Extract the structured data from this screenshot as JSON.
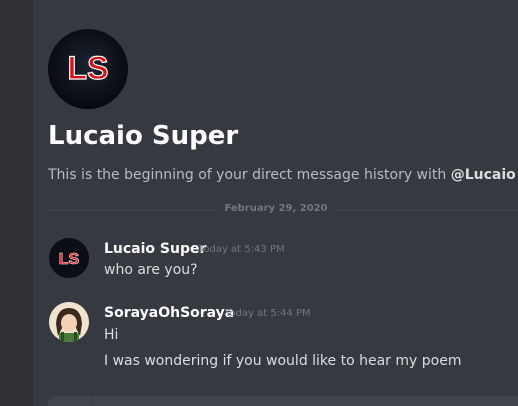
{
  "colors": {
    "background": "#36393f",
    "sidebar": "#2f3136",
    "text_primary": "#ffffff",
    "text_body": "#dcddde",
    "text_muted": "#72767d",
    "logo_red": "#e30b13"
  },
  "header": {
    "avatar_text": "LS",
    "title": "Lucaio Super",
    "subtitle_prefix": "This is the beginning of your direct message history with ",
    "subtitle_mention": "@Lucaio Super"
  },
  "date_divider": "February 29, 2020",
  "messages": [
    {
      "author": "Lucaio Super",
      "timestamp": "Today at 5:43 PM",
      "avatar_text": "LS",
      "lines": [
        "who are you?"
      ]
    },
    {
      "author": "SorayaOhSoraya",
      "timestamp": "Today at 5:44 PM",
      "lines": [
        "Hi",
        "I was wondering if you would like to hear my poem"
      ]
    }
  ]
}
